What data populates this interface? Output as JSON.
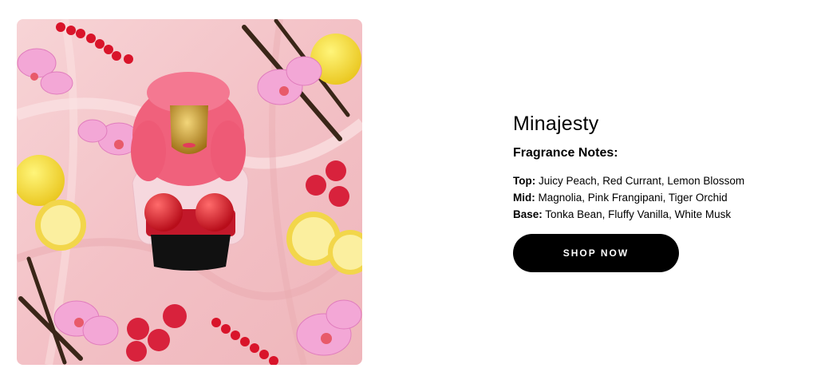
{
  "product": {
    "name": "Minajesty",
    "image_alt": "Minajesty perfume bottle with pink hair and gold face on pink silk with lemons, raspberries, red currants, orchids and vanilla",
    "notes_heading": "Fragrance Notes:",
    "notes": [
      {
        "label": "Top:",
        "value": "Juicy Peach, Red Currant, Lemon Blossom"
      },
      {
        "label": "Mid:",
        "value": "Magnolia, Pink Frangipani, Tiger Orchid"
      },
      {
        "label": "Base:",
        "value": "Tonka Bean, Fluffy Vanilla, White Musk"
      }
    ],
    "cta_label": "SHOP NOW"
  },
  "colors": {
    "silk": "#f6c9cc",
    "hair": "#f0617c",
    "gold": "#c99a2e",
    "button": "#000000"
  }
}
